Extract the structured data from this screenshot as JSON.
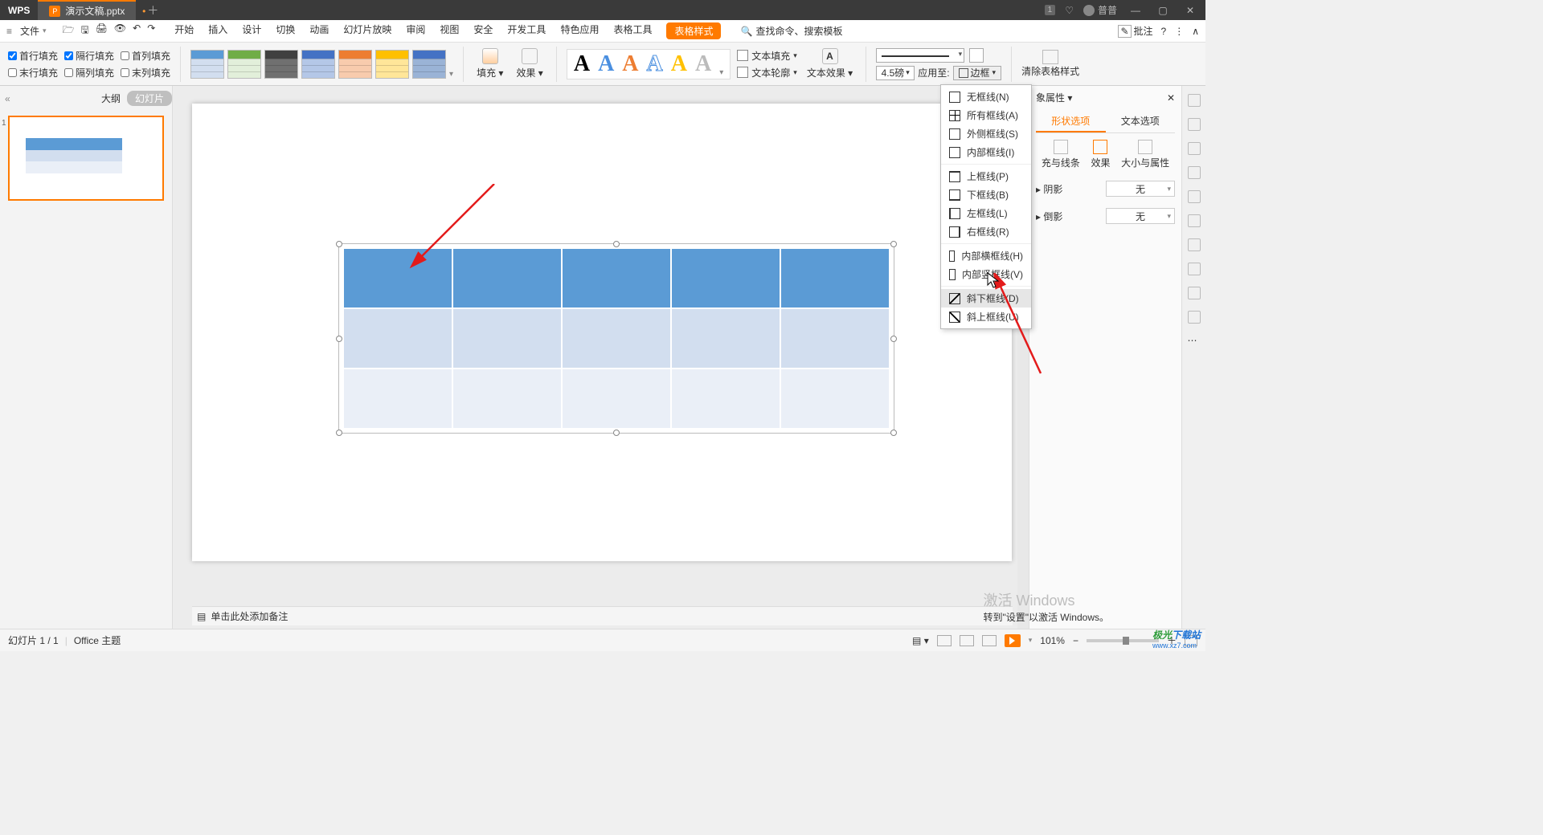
{
  "titlebar": {
    "app": "WPS",
    "tab": "演示文稿.pptx",
    "badge": "1",
    "user": "普普"
  },
  "menubar": {
    "file": "文件",
    "tabs": [
      "开始",
      "插入",
      "设计",
      "切换",
      "动画",
      "幻灯片放映",
      "审阅",
      "视图",
      "安全",
      "开发工具",
      "特色应用",
      "表格工具",
      "表格样式"
    ],
    "search": "查找命令、搜索模板",
    "annotate": "批注"
  },
  "ribbon": {
    "checks": {
      "firstRowFill": "首行填充",
      "bandedRowFill": "隔行填充",
      "firstColFill": "首列填充",
      "lastRowFill": "末行填充",
      "bandedColFill": "隔列填充",
      "lastColFill": "末列填充"
    },
    "fill": "填充",
    "effect": "效果",
    "textFill": "文本填充",
    "textOutline": "文本轮廓",
    "textEffects": "文本效果",
    "pt": "4.5磅",
    "applyTo": "应用至:",
    "border": "边框",
    "clear": "清除表格样式"
  },
  "borderMenu": {
    "none": "无框线(N)",
    "all": "所有框线(A)",
    "outside": "外侧框线(S)",
    "inside": "内部框线(I)",
    "top": "上框线(P)",
    "bottom": "下框线(B)",
    "left": "左框线(L)",
    "right": "右框线(R)",
    "insideH": "内部横框线(H)",
    "insideV": "内部竖框线(V)",
    "diagDown": "斜下框线(D)",
    "diagUp": "斜上框线(U)"
  },
  "thumbPane": {
    "outline": "大纲",
    "slides": "幻灯片"
  },
  "rightPanel": {
    "title": "象属性",
    "shapeOpt": "形状选项",
    "textOpt": "文本选项",
    "fill": "充与线条",
    "effect": "效果",
    "size": "大小与属性",
    "shadow": "阴影",
    "reflect": "倒影",
    "none": "无"
  },
  "notes": "单击此处添加备注",
  "status": {
    "slide": "幻灯片 1 / 1",
    "theme": "Office 主题",
    "zoom": "101%"
  },
  "watermark": {
    "t": "激活 Windows",
    "s": "转到\"设置\"以激活 Windows。"
  },
  "logo": {
    "brand": "极光下载站",
    "url": "www.xz7.com"
  },
  "colors": {
    "accent": "#ff7a00",
    "tblHeader": "#5b9bd5",
    "tblRow1": "#d2deef",
    "tblRow2": "#eaeff7",
    "styleHeaders": [
      "#5b9bd5",
      "#70ad47",
      "#404040",
      "#4472c4",
      "#ed7d31",
      "#ffc000",
      "#9ab3d6"
    ]
  }
}
